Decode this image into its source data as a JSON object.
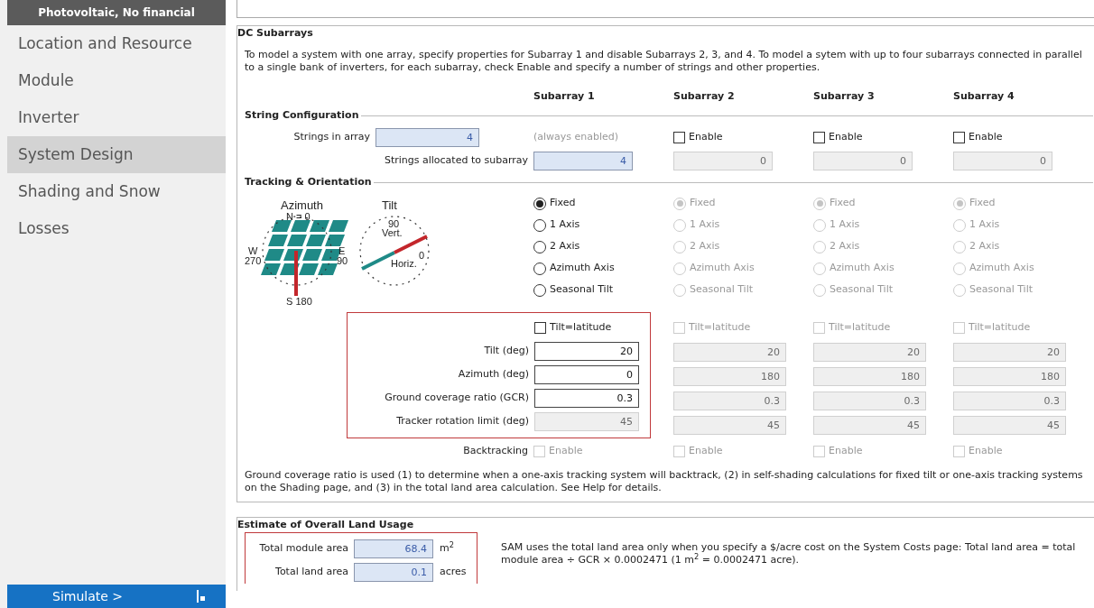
{
  "sidebar": {
    "header": "Photovoltaic, No financial",
    "items": [
      {
        "label": "Location and Resource",
        "selected": false
      },
      {
        "label": "Module",
        "selected": false
      },
      {
        "label": "Inverter",
        "selected": false
      },
      {
        "label": "System Design",
        "selected": true
      },
      {
        "label": "Shading and Snow",
        "selected": false
      },
      {
        "label": "Losses",
        "selected": false
      }
    ],
    "simulate_button": "Simulate >"
  },
  "dc_subarrays": {
    "title": "DC Subarrays",
    "intro": "To model a system with one array, specify properties for Subarray 1 and disable Subarrays 2, 3, and 4.  To model a sytem with up to four subarrays connected in parallel to a single bank of inverters, for each subarray, check Enable and specify a number of strings and other properties.",
    "string_configuration": {
      "title": "String Configuration",
      "strings_in_array_label": "Strings in array",
      "strings_in_array": "4",
      "allocated_label": "Strings allocated to subarray"
    },
    "tracking_title": "Tracking & Orientation",
    "diagram_labels": {
      "azimuth": "Azimuth",
      "north": "N = 0",
      "west": "W",
      "west_deg": "270",
      "east": "E",
      "east_deg": "90",
      "south": "S 180",
      "tilt": "Tilt",
      "vert_deg": "90",
      "vert": "Vert.",
      "horiz_deg": "0",
      "horiz": "Horiz."
    },
    "parameter_labels": [
      "Tilt (deg)",
      "Azimuth (deg)",
      "Ground coverage ratio (GCR)",
      "Tracker rotation limit (deg)"
    ],
    "backtracking_label": "Backtracking",
    "subarrays": [
      {
        "header": "Subarray 1",
        "enable": {
          "kind": "note",
          "label": "(always enabled)"
        },
        "strings": {
          "value": "4",
          "disabled": false
        },
        "tracking": [
          {
            "label": "Fixed",
            "selected": true,
            "disabled": false
          },
          {
            "label": "1 Axis",
            "selected": false,
            "disabled": false
          },
          {
            "label": "2 Axis",
            "selected": false,
            "disabled": false
          },
          {
            "label": "Azimuth Axis",
            "selected": false,
            "disabled": false
          },
          {
            "label": "Seasonal Tilt",
            "selected": false,
            "disabled": false
          }
        ],
        "tilt_latitude": {
          "label": "Tilt=latitude",
          "checked": false,
          "disabled": false
        },
        "parameters": [
          {
            "value": "20",
            "disabled": false
          },
          {
            "value": "0",
            "disabled": false
          },
          {
            "value": "0.3",
            "disabled": false
          },
          {
            "value": "45",
            "disabled": true
          }
        ],
        "backtracking": {
          "label": "Enable",
          "checked": false,
          "disabled": true
        }
      },
      {
        "header": "Subarray 2",
        "enable": {
          "kind": "checkbox",
          "label": "Enable",
          "checked": false
        },
        "strings": {
          "value": "0",
          "disabled": true
        },
        "tracking": [
          {
            "label": "Fixed",
            "selected": true,
            "disabled": true
          },
          {
            "label": "1 Axis",
            "selected": false,
            "disabled": true
          },
          {
            "label": "2 Axis",
            "selected": false,
            "disabled": true
          },
          {
            "label": "Azimuth Axis",
            "selected": false,
            "disabled": true
          },
          {
            "label": "Seasonal Tilt",
            "selected": false,
            "disabled": true
          }
        ],
        "tilt_latitude": {
          "label": "Tilt=latitude",
          "checked": false,
          "disabled": true
        },
        "parameters": [
          {
            "value": "20",
            "disabled": true
          },
          {
            "value": "180",
            "disabled": true
          },
          {
            "value": "0.3",
            "disabled": true
          },
          {
            "value": "45",
            "disabled": true
          }
        ],
        "backtracking": {
          "label": "Enable",
          "checked": false,
          "disabled": true
        }
      },
      {
        "header": "Subarray 3",
        "enable": {
          "kind": "checkbox",
          "label": "Enable",
          "checked": false
        },
        "strings": {
          "value": "0",
          "disabled": true
        },
        "tracking": [
          {
            "label": "Fixed",
            "selected": true,
            "disabled": true
          },
          {
            "label": "1 Axis",
            "selected": false,
            "disabled": true
          },
          {
            "label": "2 Axis",
            "selected": false,
            "disabled": true
          },
          {
            "label": "Azimuth Axis",
            "selected": false,
            "disabled": true
          },
          {
            "label": "Seasonal Tilt",
            "selected": false,
            "disabled": true
          }
        ],
        "tilt_latitude": {
          "label": "Tilt=latitude",
          "checked": false,
          "disabled": true
        },
        "parameters": [
          {
            "value": "20",
            "disabled": true
          },
          {
            "value": "180",
            "disabled": true
          },
          {
            "value": "0.3",
            "disabled": true
          },
          {
            "value": "45",
            "disabled": true
          }
        ],
        "backtracking": {
          "label": "Enable",
          "checked": false,
          "disabled": true
        }
      },
      {
        "header": "Subarray 4",
        "enable": {
          "kind": "checkbox",
          "label": "Enable",
          "checked": false
        },
        "strings": {
          "value": "0",
          "disabled": true
        },
        "tracking": [
          {
            "label": "Fixed",
            "selected": true,
            "disabled": true
          },
          {
            "label": "1 Axis",
            "selected": false,
            "disabled": true
          },
          {
            "label": "2 Axis",
            "selected": false,
            "disabled": true
          },
          {
            "label": "Azimuth Axis",
            "selected": false,
            "disabled": true
          },
          {
            "label": "Seasonal Tilt",
            "selected": false,
            "disabled": true
          }
        ],
        "tilt_latitude": {
          "label": "Tilt=latitude",
          "checked": false,
          "disabled": true
        },
        "parameters": [
          {
            "value": "20",
            "disabled": true
          },
          {
            "value": "180",
            "disabled": true
          },
          {
            "value": "0.3",
            "disabled": true
          },
          {
            "value": "45",
            "disabled": true
          }
        ],
        "backtracking": {
          "label": "Enable",
          "checked": false,
          "disabled": true
        }
      }
    ],
    "gcr_note": "Ground coverage ratio is used (1) to determine when a one-axis tracking system will backtrack, (2) in self-shading calculations for fixed tilt or one-axis tracking systems on the Shading page, and (3) in the total land area calculation. See Help for details."
  },
  "land_usage": {
    "title": "Estimate of Overall Land Usage",
    "rows": [
      {
        "label": "Total module area",
        "value": "68.4",
        "unit": "m$^{2}$"
      },
      {
        "label": "Total land area",
        "value": "0.1",
        "unit": "acres"
      }
    ],
    "note": "SAM uses the total land area only when you specify a $/acre cost on the System Costs page: Total land area = total module area ÷ GCR × 0.0002471 (1 m$^{2}$ = 0.0002471 acre)."
  }
}
